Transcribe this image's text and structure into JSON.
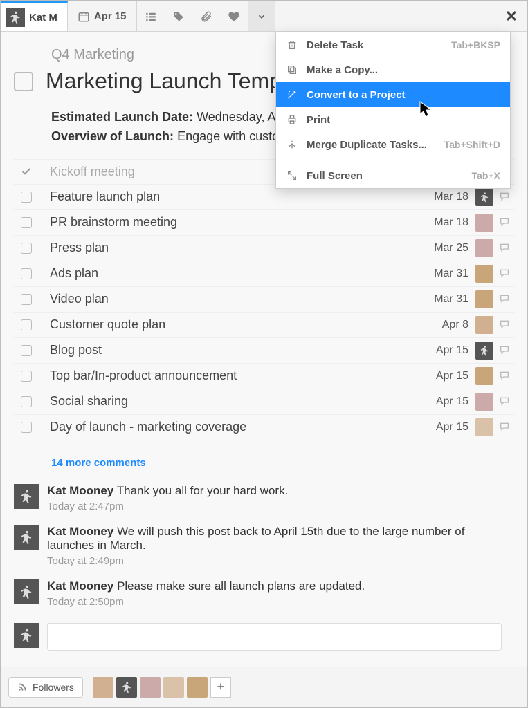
{
  "toolbar": {
    "assignee_name": "Kat M",
    "due_date": "Apr 15"
  },
  "project_label": "Q4 Marketing",
  "task_title": "Marketing Launch Temp",
  "description": {
    "date_label": "Estimated Launch Date:",
    "date_value": "Wednesday, A",
    "overview_label": "Overview of Launch:",
    "overview_value": "Engage with custo"
  },
  "subtasks": [
    {
      "title": "Kickoff meeting",
      "date": "",
      "done": true
    },
    {
      "title": "Feature launch plan",
      "date": "Mar 18"
    },
    {
      "title": "PR brainstorm meeting",
      "date": "Mar 18"
    },
    {
      "title": "Press plan",
      "date": "Mar 25"
    },
    {
      "title": "Ads plan",
      "date": "Mar 31"
    },
    {
      "title": "Video plan",
      "date": "Mar 31"
    },
    {
      "title": "Customer quote plan",
      "date": "Apr 8"
    },
    {
      "title": "Blog post",
      "date": "Apr 15"
    },
    {
      "title": "Top bar/In-product announcement",
      "date": "Apr 15"
    },
    {
      "title": "Social sharing",
      "date": "Apr 15"
    },
    {
      "title": "Day of launch - marketing coverage",
      "date": "Apr 15"
    }
  ],
  "more_comments": "14 more comments",
  "comments": [
    {
      "author": "Kat Mooney",
      "text": " Thank you all for your hard work.",
      "time": "Today at 2:47pm"
    },
    {
      "author": "Kat Mooney",
      "text": " We will push this post back to April 15th due to the large number of launches in March.",
      "time": "Today at 2:49pm"
    },
    {
      "author": "Kat Mooney",
      "text": " Please make sure all launch plans are updated.",
      "time": "Today at 2:50pm"
    }
  ],
  "followers_label": "Followers",
  "dropdown": {
    "delete": "Delete Task",
    "delete_sc": "Tab+BKSP",
    "copy": "Make a Copy...",
    "convert": "Convert to a Project",
    "print": "Print",
    "merge": "Merge Duplicate Tasks...",
    "merge_sc": "Tab+Shift+D",
    "full": "Full Screen",
    "full_sc": "Tab+X"
  }
}
